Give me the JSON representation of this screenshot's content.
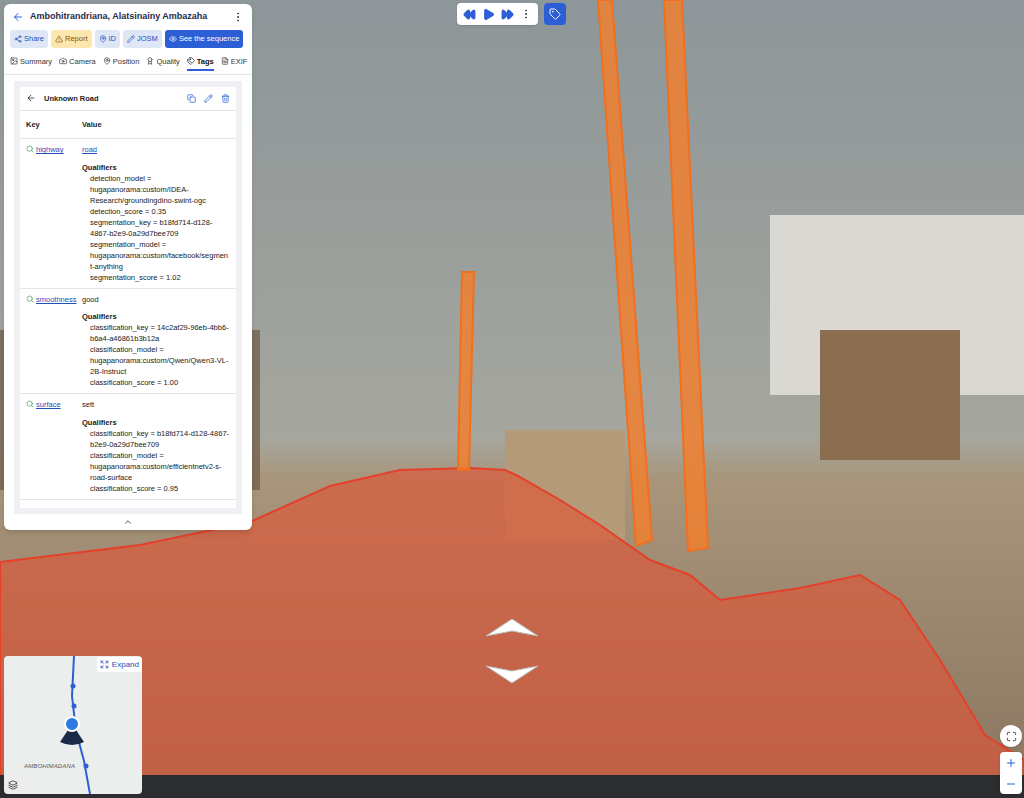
{
  "header": {
    "title": "Ambohitrandriana, Alatsinainy Ambazaha"
  },
  "actions": [
    {
      "label": "Share",
      "kind": "share"
    },
    {
      "label": "Report",
      "kind": "report"
    },
    {
      "label": "ID",
      "kind": "id"
    },
    {
      "label": "JOSM",
      "kind": "josm"
    },
    {
      "label": "See the sequence",
      "kind": "sequence"
    }
  ],
  "tabs": [
    {
      "label": "Summary",
      "selected": false
    },
    {
      "label": "Camera",
      "selected": false
    },
    {
      "label": "Position",
      "selected": false
    },
    {
      "label": "Quality",
      "selected": false
    },
    {
      "label": "Tags",
      "selected": true
    },
    {
      "label": "EXIF",
      "selected": false
    }
  ],
  "tag_card": {
    "title": "Unknown Road",
    "columns": [
      "Key",
      "Value"
    ],
    "qualifiers_label": "Qualifiers",
    "rows": [
      {
        "key": "highway",
        "value": "road",
        "value_link": true,
        "qualifiers": [
          "detection_model = hugapanorama:custom/IDEA-Research/groundingdino-swint-ogc",
          "detection_score = 0.35",
          "segmentation_key = b18fd714-d128-4867-b2e9-0a29d7bee709",
          "segmentation_model = hugapanorama:custom/facebook/segment-anything",
          "segmentation_score = 1.02"
        ]
      },
      {
        "key": "smoothness",
        "value": "good",
        "value_link": false,
        "qualifiers": [
          "classification_key = 14c2af29-96eb-4bb6-b6a4-a46861b3b12a",
          "classification_model = hugapanorama:custom/Qwen/Qwen3-VL-2B-Instruct",
          "classification_score = 1.00"
        ]
      },
      {
        "key": "surface",
        "value": "sett",
        "value_link": false,
        "qualifiers": [
          "classification_key = b18fd714-d128-4867-b2e9-0a29d7bee709",
          "classification_model = hugapanorama:custom/efficientnetv2-s-road-surface",
          "classification_score = 0.95"
        ]
      }
    ]
  },
  "minimap": {
    "expand": "Expand",
    "place_label": "AMBOHIMADANA"
  }
}
